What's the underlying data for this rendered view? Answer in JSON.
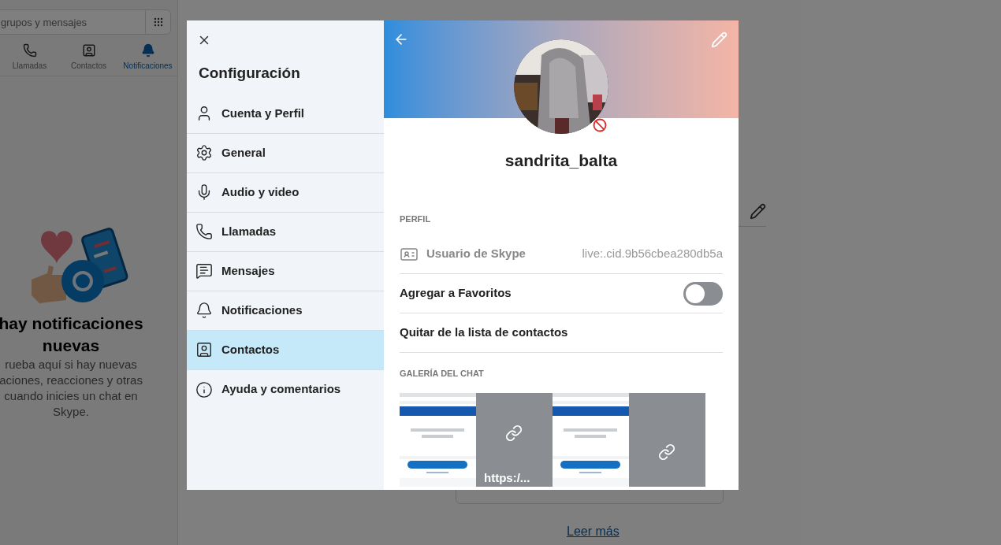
{
  "background": {
    "search": {
      "placeholder": "grupos y mensajes"
    },
    "tabs": [
      {
        "label": "Llamadas",
        "selected": false
      },
      {
        "label": "Contactos",
        "selected": false
      },
      {
        "label": "Notificaciones",
        "selected": true
      }
    ],
    "empty_state": {
      "title_lines": [
        "hay notificaciones",
        "nuevas"
      ],
      "body_lines": [
        "rueba aquí si hay nuevas",
        "aciones, reacciones y otras",
        "cuando inicies un chat en",
        "Skype."
      ]
    },
    "link": "Leer más"
  },
  "dialog": {
    "title": "Configuración",
    "nav": [
      {
        "label": "Cuenta y Perfil",
        "selected": false
      },
      {
        "label": "General",
        "selected": false
      },
      {
        "label": "Audio y video",
        "selected": false
      },
      {
        "label": "Llamadas",
        "selected": false
      },
      {
        "label": "Mensajes",
        "selected": false
      },
      {
        "label": "Notificaciones",
        "selected": false
      },
      {
        "label": "Contactos",
        "selected": true
      },
      {
        "label": "Ayuda y comentarios",
        "selected": false
      }
    ],
    "profile": {
      "name": "sandrita_balta",
      "blocked": true,
      "section": "PERFIL",
      "skype_user": {
        "label": "Usuario de Skype",
        "value": "live:.cid.9b56cbea280db5a"
      },
      "favorites": {
        "label": "Agregar a Favoritos",
        "on": false
      },
      "remove": "Quitar de la lista de contactos",
      "gallery_title": "GALERÍA DEL CHAT",
      "gallery": [
        {
          "kind": "picture"
        },
        {
          "kind": "link",
          "text": "https:/..."
        },
        {
          "kind": "picture"
        },
        {
          "kind": "link"
        }
      ]
    }
  }
}
